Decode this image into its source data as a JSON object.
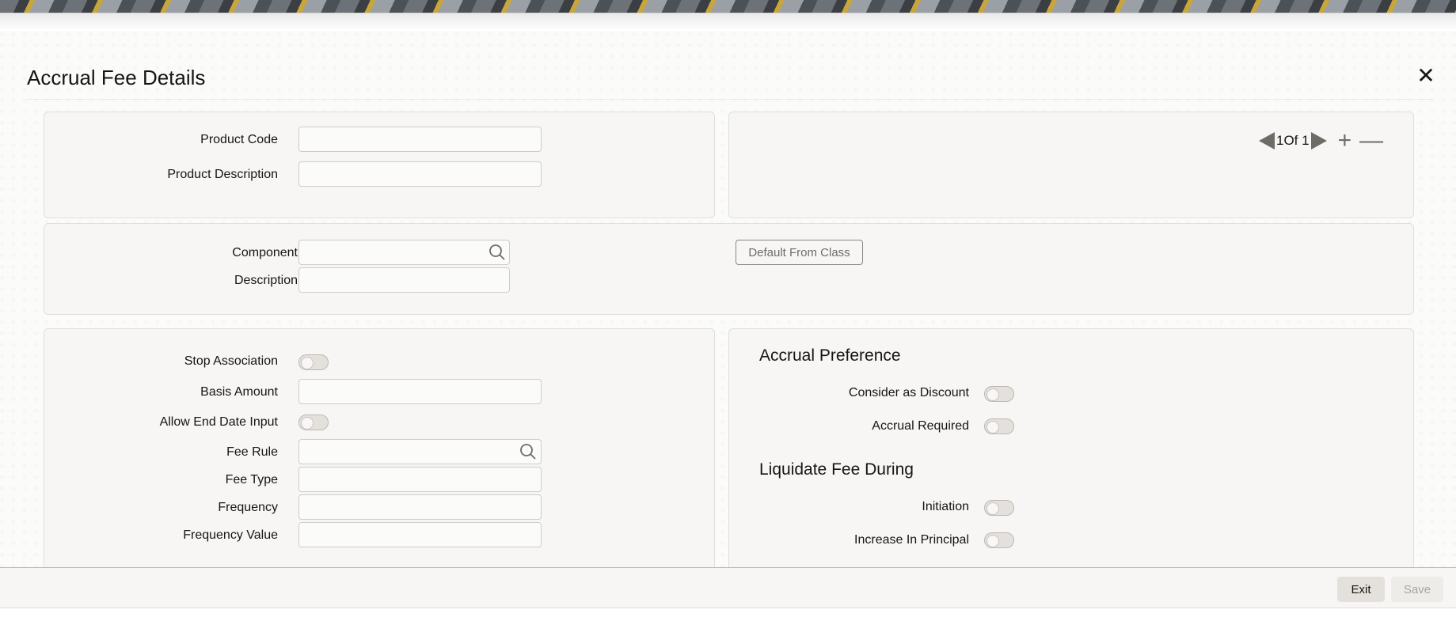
{
  "dialog": {
    "title": "Accrual Fee Details",
    "close_label": "✕"
  },
  "product": {
    "code_label": "Product Code",
    "code_value": "",
    "description_label": "Product Description",
    "description_value": ""
  },
  "pager": {
    "text": "1Of 1",
    "plus": "+",
    "minus": "—"
  },
  "component": {
    "component_label": "Component",
    "component_value": "",
    "description_label": "Description",
    "description_value": "",
    "default_button": "Default From Class"
  },
  "fee": {
    "stop_association_label": "Stop Association",
    "basis_amount_label": "Basis Amount",
    "basis_amount_value": "",
    "allow_end_date_label": "Allow End Date Input",
    "fee_rule_label": "Fee Rule",
    "fee_rule_value": "",
    "fee_type_label": "Fee Type",
    "fee_type_value": "",
    "frequency_label": "Frequency",
    "frequency_value": "",
    "frequency_value_label": "Frequency Value",
    "frequency_value_value": ""
  },
  "accrual_preference": {
    "heading": "Accrual Preference",
    "consider_discount_label": "Consider as Discount",
    "accrual_required_label": "Accrual Required"
  },
  "liquidate": {
    "heading": "Liquidate Fee During",
    "initiation_label": "Initiation",
    "increase_principal_label": "Increase In Principal"
  },
  "footer": {
    "exit_label": "Exit",
    "save_label": "Save"
  },
  "colors": {
    "panel_bg": "#f7f6f4",
    "text": "#161513",
    "muted": "#6f6b67"
  }
}
